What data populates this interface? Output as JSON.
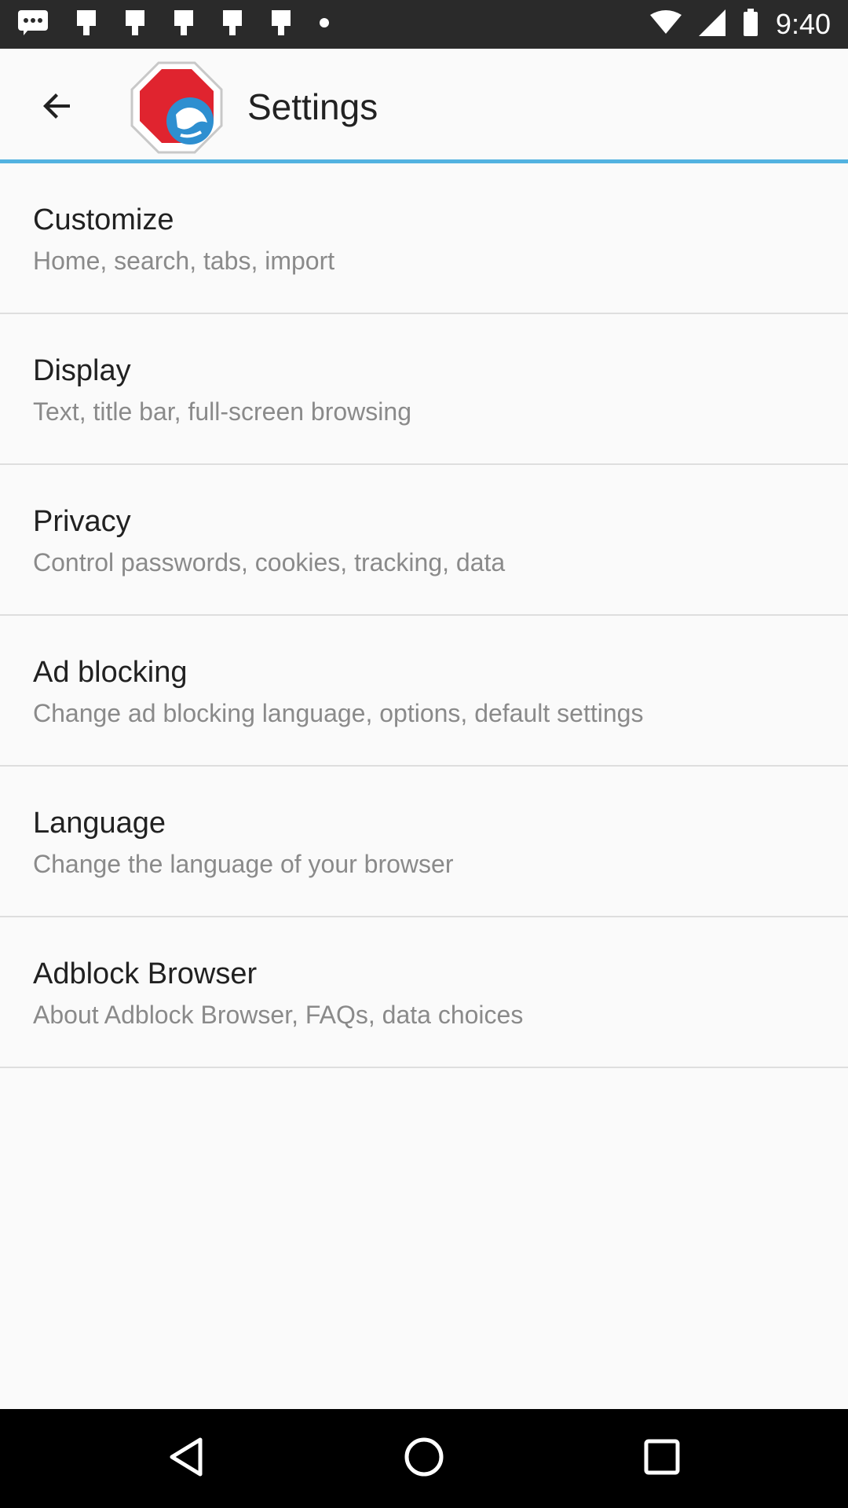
{
  "status_bar": {
    "time": "9:40",
    "icons": [
      "chat-bubble-icon",
      "notification-icon",
      "notification-icon",
      "notification-icon",
      "notification-icon",
      "notification-icon",
      "dot-icon",
      "wifi-icon",
      "signal-icon",
      "battery-icon"
    ]
  },
  "app_bar": {
    "title": "Settings",
    "back_icon": "arrow-back-icon",
    "logo_icon": "adblock-browser-logo",
    "accent_color": "#52b2e0"
  },
  "settings": [
    {
      "title": "Customize",
      "subtitle": "Home, search, tabs, import"
    },
    {
      "title": "Display",
      "subtitle": "Text, title bar, full-screen browsing"
    },
    {
      "title": "Privacy",
      "subtitle": "Control passwords, cookies, tracking, data"
    },
    {
      "title": "Ad blocking",
      "subtitle": "Change ad blocking language, options, default settings"
    },
    {
      "title": "Language",
      "subtitle": "Change the language of your browser"
    },
    {
      "title": "Adblock Browser",
      "subtitle": "About Adblock Browser, FAQs, data choices"
    }
  ],
  "nav_bar": {
    "buttons": [
      "back-triangle-icon",
      "home-circle-icon",
      "recents-square-icon"
    ]
  }
}
